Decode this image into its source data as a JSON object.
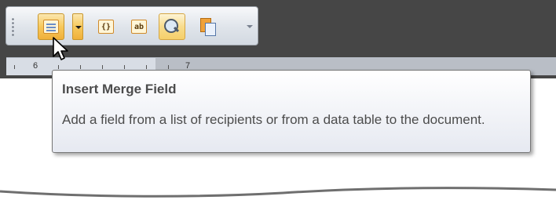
{
  "toolbar": {
    "buttons": [
      {
        "name": "Insert Merge Field",
        "icon": "insert-merge-field-icon"
      },
      {
        "name": "Insert Merge Field dropdown",
        "icon": "chevron-down-icon"
      },
      {
        "name": "Highlight Merge Fields",
        "icon": "highlight-merge-fields-icon",
        "glyph": "{}"
      },
      {
        "name": "Insert Address Block",
        "icon": "address-block-icon",
        "glyph": "ab"
      },
      {
        "name": "Preview Results",
        "icon": "preview-results-icon"
      },
      {
        "name": "Mail Merge",
        "icon": "mail-merge-icon"
      }
    ],
    "more_icon": "overflow-chevron-icon"
  },
  "ruler": {
    "numbers": [
      "6",
      "7"
    ]
  },
  "tooltip": {
    "title": "Insert Merge Field",
    "description": "Add a field from a list of recipients or from a data table to the document."
  },
  "colors": {
    "pressed": "#f7c95c",
    "toolbar_bg": "#dfe4ea",
    "dark_bg": "#464646"
  }
}
